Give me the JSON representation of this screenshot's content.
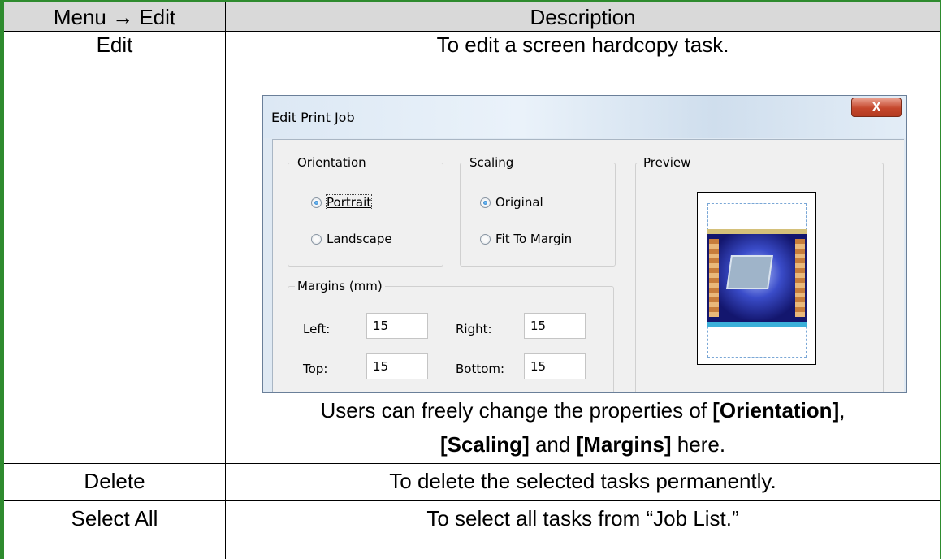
{
  "table": {
    "header": {
      "col1": "Menu → Edit",
      "col2": "Description"
    },
    "rows": [
      {
        "name": "Edit",
        "description": "To edit a screen hardcopy task.",
        "note_prefix": "Users can freely change the properties of ",
        "note_orientation": "[Orientation]",
        "note_comma": ",",
        "note_scaling": "[Scaling]",
        "note_and": " and ",
        "note_margins": "[Margins]",
        "note_suffix": " here."
      },
      {
        "name": "Delete",
        "description": "To delete the selected tasks permanently."
      },
      {
        "name": "Select All",
        "description": "To select all tasks from “Job List.”"
      }
    ]
  },
  "dialog": {
    "title": "Edit Print Job",
    "close_label": "X",
    "orientation": {
      "label": "Orientation",
      "options": [
        {
          "label": "Portrait",
          "selected": true
        },
        {
          "label": "Landscape",
          "selected": false
        }
      ]
    },
    "scaling": {
      "label": "Scaling",
      "options": [
        {
          "label": "Original",
          "selected": true
        },
        {
          "label": "Fit To Margin",
          "selected": false
        }
      ]
    },
    "preview": {
      "label": "Preview"
    },
    "margins": {
      "label": "Margins (mm)",
      "left_label": "Left:",
      "left_value": "15",
      "right_label": "Right:",
      "right_value": "15",
      "top_label": "Top:",
      "top_value": "15",
      "bottom_label": "Bottom:",
      "bottom_value": "15"
    }
  },
  "colors": {
    "table_border": "#2e8b2e",
    "header_bg": "#d9d9d9",
    "close_button": "#c5472c"
  }
}
